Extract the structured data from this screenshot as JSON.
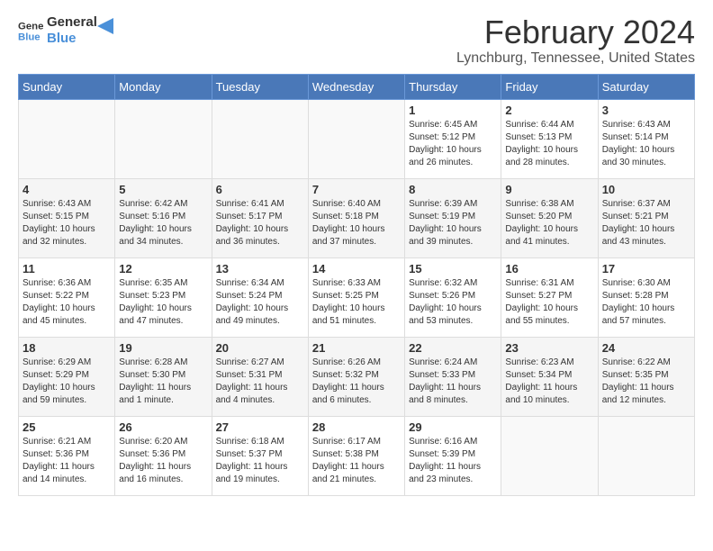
{
  "logo": {
    "text_general": "General",
    "text_blue": "Blue"
  },
  "title": "February 2024",
  "subtitle": "Lynchburg, Tennessee, United States",
  "header_days": [
    "Sunday",
    "Monday",
    "Tuesday",
    "Wednesday",
    "Thursday",
    "Friday",
    "Saturday"
  ],
  "weeks": [
    [
      {
        "day": "",
        "sunrise": "",
        "sunset": "",
        "daylight": ""
      },
      {
        "day": "",
        "sunrise": "",
        "sunset": "",
        "daylight": ""
      },
      {
        "day": "",
        "sunrise": "",
        "sunset": "",
        "daylight": ""
      },
      {
        "day": "",
        "sunrise": "",
        "sunset": "",
        "daylight": ""
      },
      {
        "day": "1",
        "sunrise": "Sunrise: 6:45 AM",
        "sunset": "Sunset: 5:12 PM",
        "daylight": "Daylight: 10 hours and 26 minutes."
      },
      {
        "day": "2",
        "sunrise": "Sunrise: 6:44 AM",
        "sunset": "Sunset: 5:13 PM",
        "daylight": "Daylight: 10 hours and 28 minutes."
      },
      {
        "day": "3",
        "sunrise": "Sunrise: 6:43 AM",
        "sunset": "Sunset: 5:14 PM",
        "daylight": "Daylight: 10 hours and 30 minutes."
      }
    ],
    [
      {
        "day": "4",
        "sunrise": "Sunrise: 6:43 AM",
        "sunset": "Sunset: 5:15 PM",
        "daylight": "Daylight: 10 hours and 32 minutes."
      },
      {
        "day": "5",
        "sunrise": "Sunrise: 6:42 AM",
        "sunset": "Sunset: 5:16 PM",
        "daylight": "Daylight: 10 hours and 34 minutes."
      },
      {
        "day": "6",
        "sunrise": "Sunrise: 6:41 AM",
        "sunset": "Sunset: 5:17 PM",
        "daylight": "Daylight: 10 hours and 36 minutes."
      },
      {
        "day": "7",
        "sunrise": "Sunrise: 6:40 AM",
        "sunset": "Sunset: 5:18 PM",
        "daylight": "Daylight: 10 hours and 37 minutes."
      },
      {
        "day": "8",
        "sunrise": "Sunrise: 6:39 AM",
        "sunset": "Sunset: 5:19 PM",
        "daylight": "Daylight: 10 hours and 39 minutes."
      },
      {
        "day": "9",
        "sunrise": "Sunrise: 6:38 AM",
        "sunset": "Sunset: 5:20 PM",
        "daylight": "Daylight: 10 hours and 41 minutes."
      },
      {
        "day": "10",
        "sunrise": "Sunrise: 6:37 AM",
        "sunset": "Sunset: 5:21 PM",
        "daylight": "Daylight: 10 hours and 43 minutes."
      }
    ],
    [
      {
        "day": "11",
        "sunrise": "Sunrise: 6:36 AM",
        "sunset": "Sunset: 5:22 PM",
        "daylight": "Daylight: 10 hours and 45 minutes."
      },
      {
        "day": "12",
        "sunrise": "Sunrise: 6:35 AM",
        "sunset": "Sunset: 5:23 PM",
        "daylight": "Daylight: 10 hours and 47 minutes."
      },
      {
        "day": "13",
        "sunrise": "Sunrise: 6:34 AM",
        "sunset": "Sunset: 5:24 PM",
        "daylight": "Daylight: 10 hours and 49 minutes."
      },
      {
        "day": "14",
        "sunrise": "Sunrise: 6:33 AM",
        "sunset": "Sunset: 5:25 PM",
        "daylight": "Daylight: 10 hours and 51 minutes."
      },
      {
        "day": "15",
        "sunrise": "Sunrise: 6:32 AM",
        "sunset": "Sunset: 5:26 PM",
        "daylight": "Daylight: 10 hours and 53 minutes."
      },
      {
        "day": "16",
        "sunrise": "Sunrise: 6:31 AM",
        "sunset": "Sunset: 5:27 PM",
        "daylight": "Daylight: 10 hours and 55 minutes."
      },
      {
        "day": "17",
        "sunrise": "Sunrise: 6:30 AM",
        "sunset": "Sunset: 5:28 PM",
        "daylight": "Daylight: 10 hours and 57 minutes."
      }
    ],
    [
      {
        "day": "18",
        "sunrise": "Sunrise: 6:29 AM",
        "sunset": "Sunset: 5:29 PM",
        "daylight": "Daylight: 10 hours and 59 minutes."
      },
      {
        "day": "19",
        "sunrise": "Sunrise: 6:28 AM",
        "sunset": "Sunset: 5:30 PM",
        "daylight": "Daylight: 11 hours and 1 minute."
      },
      {
        "day": "20",
        "sunrise": "Sunrise: 6:27 AM",
        "sunset": "Sunset: 5:31 PM",
        "daylight": "Daylight: 11 hours and 4 minutes."
      },
      {
        "day": "21",
        "sunrise": "Sunrise: 6:26 AM",
        "sunset": "Sunset: 5:32 PM",
        "daylight": "Daylight: 11 hours and 6 minutes."
      },
      {
        "day": "22",
        "sunrise": "Sunrise: 6:24 AM",
        "sunset": "Sunset: 5:33 PM",
        "daylight": "Daylight: 11 hours and 8 minutes."
      },
      {
        "day": "23",
        "sunrise": "Sunrise: 6:23 AM",
        "sunset": "Sunset: 5:34 PM",
        "daylight": "Daylight: 11 hours and 10 minutes."
      },
      {
        "day": "24",
        "sunrise": "Sunrise: 6:22 AM",
        "sunset": "Sunset: 5:35 PM",
        "daylight": "Daylight: 11 hours and 12 minutes."
      }
    ],
    [
      {
        "day": "25",
        "sunrise": "Sunrise: 6:21 AM",
        "sunset": "Sunset: 5:36 PM",
        "daylight": "Daylight: 11 hours and 14 minutes."
      },
      {
        "day": "26",
        "sunrise": "Sunrise: 6:20 AM",
        "sunset": "Sunset: 5:36 PM",
        "daylight": "Daylight: 11 hours and 16 minutes."
      },
      {
        "day": "27",
        "sunrise": "Sunrise: 6:18 AM",
        "sunset": "Sunset: 5:37 PM",
        "daylight": "Daylight: 11 hours and 19 minutes."
      },
      {
        "day": "28",
        "sunrise": "Sunrise: 6:17 AM",
        "sunset": "Sunset: 5:38 PM",
        "daylight": "Daylight: 11 hours and 21 minutes."
      },
      {
        "day": "29",
        "sunrise": "Sunrise: 6:16 AM",
        "sunset": "Sunset: 5:39 PM",
        "daylight": "Daylight: 11 hours and 23 minutes."
      },
      {
        "day": "",
        "sunrise": "",
        "sunset": "",
        "daylight": ""
      },
      {
        "day": "",
        "sunrise": "",
        "sunset": "",
        "daylight": ""
      }
    ]
  ]
}
